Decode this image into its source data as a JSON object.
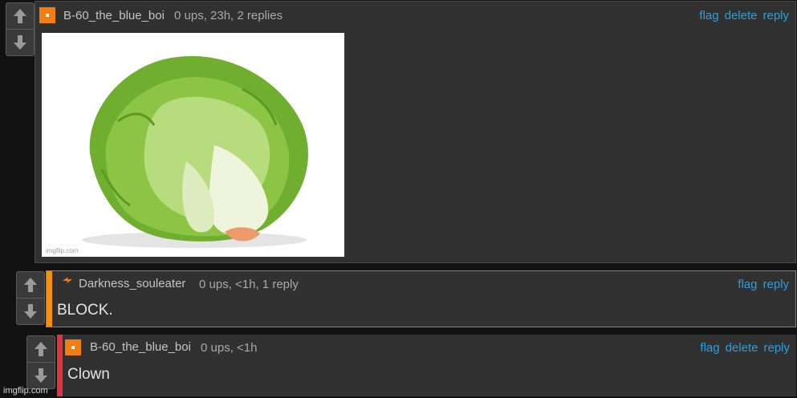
{
  "comments": [
    {
      "username": "B-60_the_blue_boi",
      "meta": "0 ups, 23h, 2 replies",
      "actions": [
        "flag",
        "delete",
        "reply"
      ],
      "avatar": "orange-square-avatar",
      "image": {
        "subject": "iceberg lettuce",
        "watermark": "imgflip.com"
      }
    },
    {
      "username": "Darkness_souleater",
      "meta": "0 ups, <1h, 1 reply",
      "actions": [
        "flag",
        "reply"
      ],
      "avatar": "orange-lightning-avatar",
      "text": "BLOCK.",
      "stripe_color": "#f0920e"
    },
    {
      "username": "B-60_the_blue_boi",
      "meta": "0 ups, <1h",
      "actions": [
        "flag",
        "delete",
        "reply"
      ],
      "avatar": "orange-square-avatar",
      "text": "Clown",
      "stripe_color": "#e0333c"
    }
  ],
  "watermark": "imgflip.com",
  "colors": {
    "link": "#2aa0e0",
    "card_bg": "#313131",
    "avatar": "#f27e12"
  }
}
